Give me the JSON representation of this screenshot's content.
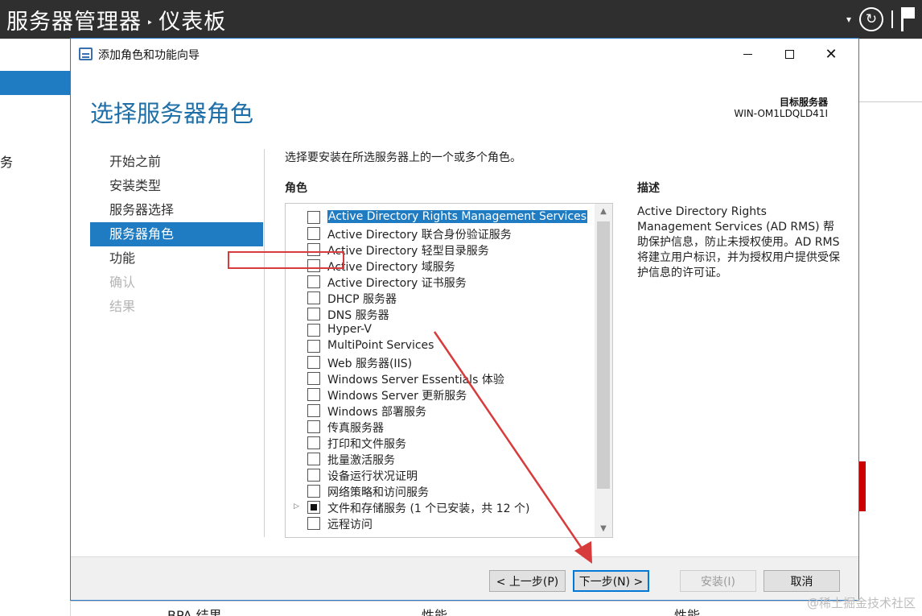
{
  "app": {
    "title": "服务器管理器",
    "breadcrumb_separator": "‣",
    "page": "仪表板",
    "left_partial_text": "务",
    "bottom_tiles": [
      "BPA 结果",
      "性能",
      "性能"
    ]
  },
  "dialog": {
    "title": "添加角色和功能向导",
    "page_title": "选择服务器角色",
    "target_label": "目标服务器",
    "target_name": "WIN-OM1LDQLD41I",
    "nav": [
      {
        "label": "开始之前",
        "state": "normal"
      },
      {
        "label": "安装类型",
        "state": "normal"
      },
      {
        "label": "服务器选择",
        "state": "normal"
      },
      {
        "label": "服务器角色",
        "state": "active"
      },
      {
        "label": "功能",
        "state": "normal"
      },
      {
        "label": "确认",
        "state": "disabled"
      },
      {
        "label": "结果",
        "state": "disabled"
      }
    ],
    "instruction": "选择要安装在所选服务器上的一个或多个角色。",
    "roles_label": "角色",
    "description_label": "描述",
    "description": "Active Directory Rights Management Services (AD RMS) 帮助保护信息，防止未授权使用。AD RMS 将建立用户标识，并为授权用户提供受保护信息的许可证。",
    "roles": [
      {
        "label": "Active Directory Rights Management Services",
        "checked": false,
        "selected": true
      },
      {
        "label": "Active Directory 联合身份验证服务",
        "checked": false
      },
      {
        "label": "Active Directory 轻型目录服务",
        "checked": false
      },
      {
        "label": "Active Directory 域服务",
        "checked": false
      },
      {
        "label": "Active Directory 证书服务",
        "checked": false
      },
      {
        "label": "DHCP 服务器",
        "checked": false
      },
      {
        "label": "DNS 服务器",
        "checked": false
      },
      {
        "label": "Hyper-V",
        "checked": false
      },
      {
        "label": "MultiPoint Services",
        "checked": false
      },
      {
        "label": "Web 服务器(IIS)",
        "checked": false
      },
      {
        "label": "Windows Server Essentials 体验",
        "checked": false
      },
      {
        "label": "Windows Server 更新服务",
        "checked": false
      },
      {
        "label": "Windows 部署服务",
        "checked": false
      },
      {
        "label": "传真服务器",
        "checked": false
      },
      {
        "label": "打印和文件服务",
        "checked": false
      },
      {
        "label": "批量激活服务",
        "checked": false
      },
      {
        "label": "设备运行状况证明",
        "checked": false
      },
      {
        "label": "网络策略和访问服务",
        "checked": false
      },
      {
        "label": "文件和存储服务 (1 个已安装，共 12 个)",
        "checked": "partial",
        "expander": true
      },
      {
        "label": "远程访问",
        "checked": false
      }
    ],
    "buttons": {
      "prev": "< 上一步(P)",
      "next": "下一步(N) >",
      "install": "安装(I)",
      "cancel": "取消"
    }
  },
  "watermark": "@稀土掘金技术社区",
  "colors": {
    "accent": "#1f7cc2",
    "title_blue": "#1e6fa8",
    "annotation_red": "#d83b3b"
  }
}
